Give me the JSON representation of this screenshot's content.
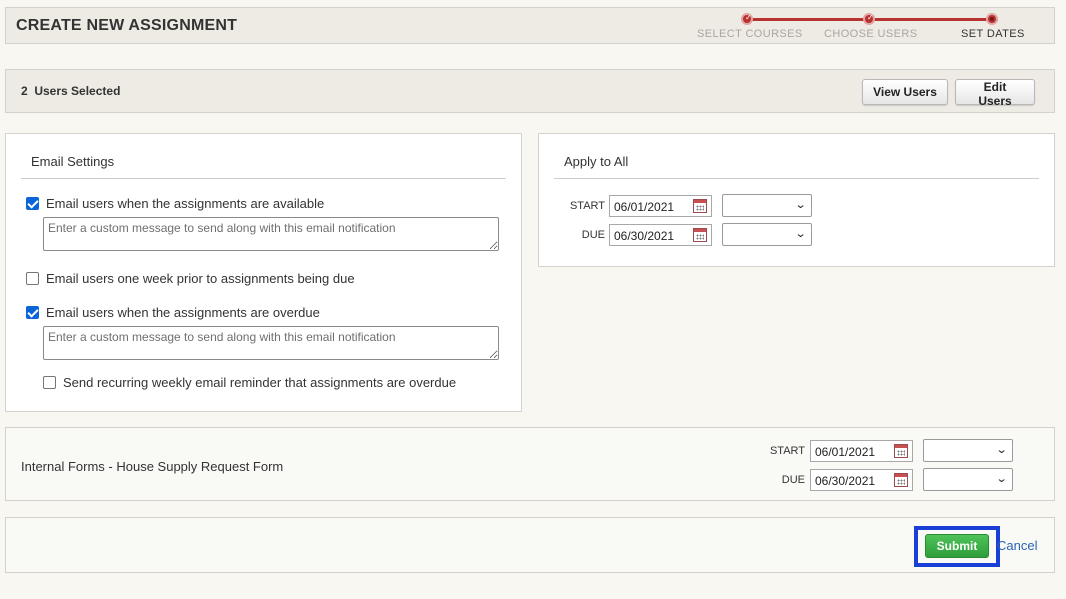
{
  "header": {
    "title": "CREATE NEW ASSIGNMENT",
    "steps": [
      {
        "label": "SELECT COURSES",
        "state": "complete"
      },
      {
        "label": "CHOOSE USERS",
        "state": "complete"
      },
      {
        "label": "SET DATES",
        "state": "active"
      }
    ]
  },
  "users_bar": {
    "count_text": "2  Users Selected",
    "view_label": "View Users",
    "edit_label": "Edit Users"
  },
  "email_settings": {
    "title": "Email Settings",
    "options": [
      {
        "label": "Email users when the assignments are available",
        "checked": true,
        "placeholder": "Enter a custom message to send along with this email notification"
      },
      {
        "label": "Email users one week prior to assignments being due",
        "checked": false
      },
      {
        "label": "Email users when the assignments are overdue",
        "checked": true,
        "placeholder": "Enter a custom message to send along with this email notification"
      },
      {
        "label": "Send recurring weekly email reminder that assignments are overdue",
        "checked": false
      }
    ]
  },
  "apply_all": {
    "title": "Apply to All",
    "start_label": "START",
    "start_value": "06/01/2021",
    "due_label": "DUE",
    "due_value": "06/30/2021"
  },
  "form_row": {
    "name": "Internal Forms - House Supply Request Form",
    "start_label": "START",
    "start_value": "06/01/2021",
    "due_label": "DUE",
    "due_value": "06/30/2021"
  },
  "actions": {
    "submit_label": "Submit",
    "cancel_label": "Cancel"
  },
  "colors": {
    "accent_red": "#b83232",
    "submit_green": "#2e9e3a",
    "focus_blue": "#1a3fd6",
    "link_blue": "#2a62b8",
    "checkbox_blue": "#0a66d8"
  },
  "icons": [
    "check-icon",
    "calendar-icon",
    "chevron-down-icon"
  ]
}
